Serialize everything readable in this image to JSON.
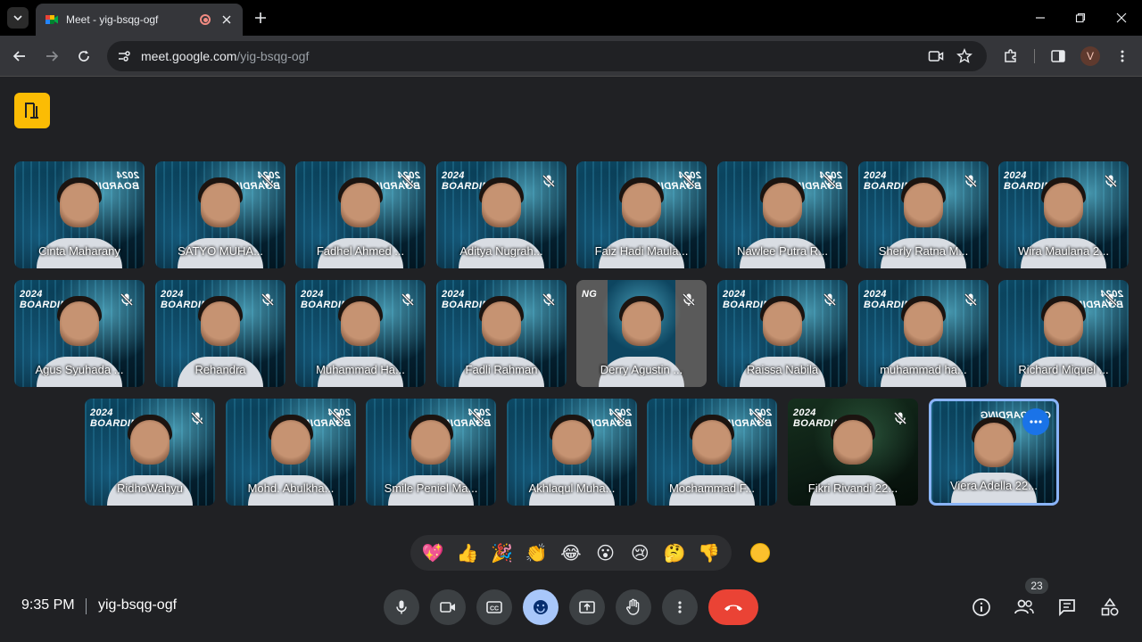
{
  "browser": {
    "tab_title": "Meet - yig-bsqg-ogf",
    "url_host": "meet.google.com",
    "url_path": "/yig-bsqg-ogf",
    "profile_initial": "V"
  },
  "participants": [
    {
      "name": "Cinta Maharany",
      "banner": "2024\nBOARDING",
      "mirror": true,
      "muted": false
    },
    {
      "name": "SATYO MUHA...",
      "banner": "2024\nBOARDING",
      "mirror": true,
      "muted": true
    },
    {
      "name": "Fadhel Ahmed ...",
      "banner": "2024\nBOARDING",
      "mirror": true,
      "muted": true
    },
    {
      "name": "Aditya Nugrah...",
      "banner": "2024\nBOARDING",
      "mirror": false,
      "muted": true
    },
    {
      "name": "Faiz Hadi Maula...",
      "banner": "2024\nBOARDING",
      "mirror": true,
      "muted": true
    },
    {
      "name": "Nawlee Putra R...",
      "banner": "2024\nBOARDING",
      "mirror": true,
      "muted": true
    },
    {
      "name": "Sherly Ratna M...",
      "banner": "2024\nBOARDING",
      "mirror": false,
      "muted": true
    },
    {
      "name": "Wira Maulana 2...",
      "banner": "2024\nBOARDING",
      "mirror": false,
      "muted": true
    },
    {
      "name": "Agus Syuhada ...",
      "banner": "2024\nBOARDING",
      "mirror": false,
      "muted": true
    },
    {
      "name": "Rehandra",
      "banner": "2024\nBOARDING",
      "mirror": false,
      "muted": true
    },
    {
      "name": "Muhammad Ha...",
      "banner": "2024\nBOARDING",
      "mirror": false,
      "muted": true
    },
    {
      "name": "Fadli Rahman",
      "banner": "2024\nBOARDING",
      "mirror": false,
      "muted": true
    },
    {
      "name": "Derry Agustin ...",
      "banner": "NG",
      "mirror": false,
      "muted": true
    },
    {
      "name": "Raissa Nabila",
      "banner": "2024\nBOARDING",
      "mirror": false,
      "muted": true
    },
    {
      "name": "muhammad ha...",
      "banner": "2024\nBOARDING",
      "mirror": false,
      "muted": true
    },
    {
      "name": "Richard Miquel ...",
      "banner": "2024\nBOARDING",
      "mirror": true,
      "muted": true
    },
    {
      "name": "RidhoWahyu",
      "banner": "2024\nBOARDING",
      "mirror": false,
      "muted": true
    },
    {
      "name": "Mohd. Abulkha...",
      "banner": "2024\nBOARDING",
      "mirror": true,
      "muted": true
    },
    {
      "name": "Smile Peniel Ma...",
      "banner": "2024\nBOARDING",
      "mirror": true,
      "muted": true
    },
    {
      "name": "Akhlaqul Muha...",
      "banner": "2024\nBOARDING",
      "mirror": true,
      "muted": true
    },
    {
      "name": "Mochammad F...",
      "banner": "2024\nBOARDING",
      "mirror": true,
      "muted": true
    },
    {
      "name": "Fikri Rivandi 22...",
      "banner": "2024\nBOARDING",
      "mirror": false,
      "muted": true
    },
    {
      "name": "Viera Adella 22...",
      "banner": "ONBOARDING",
      "mirror": true,
      "muted": false
    }
  ],
  "reactions": [
    "💖",
    "👍",
    "🎉",
    "👏",
    "😂",
    "😮",
    "😢",
    "🤔",
    "👎"
  ],
  "footer": {
    "time": "9:35 PM",
    "meeting_code": "yig-bsqg-ogf",
    "participant_count": "23"
  },
  "colors": {
    "end_call": "#ea4335",
    "active_border": "#8ab4f8",
    "meet_logo": "#fbbc04"
  }
}
